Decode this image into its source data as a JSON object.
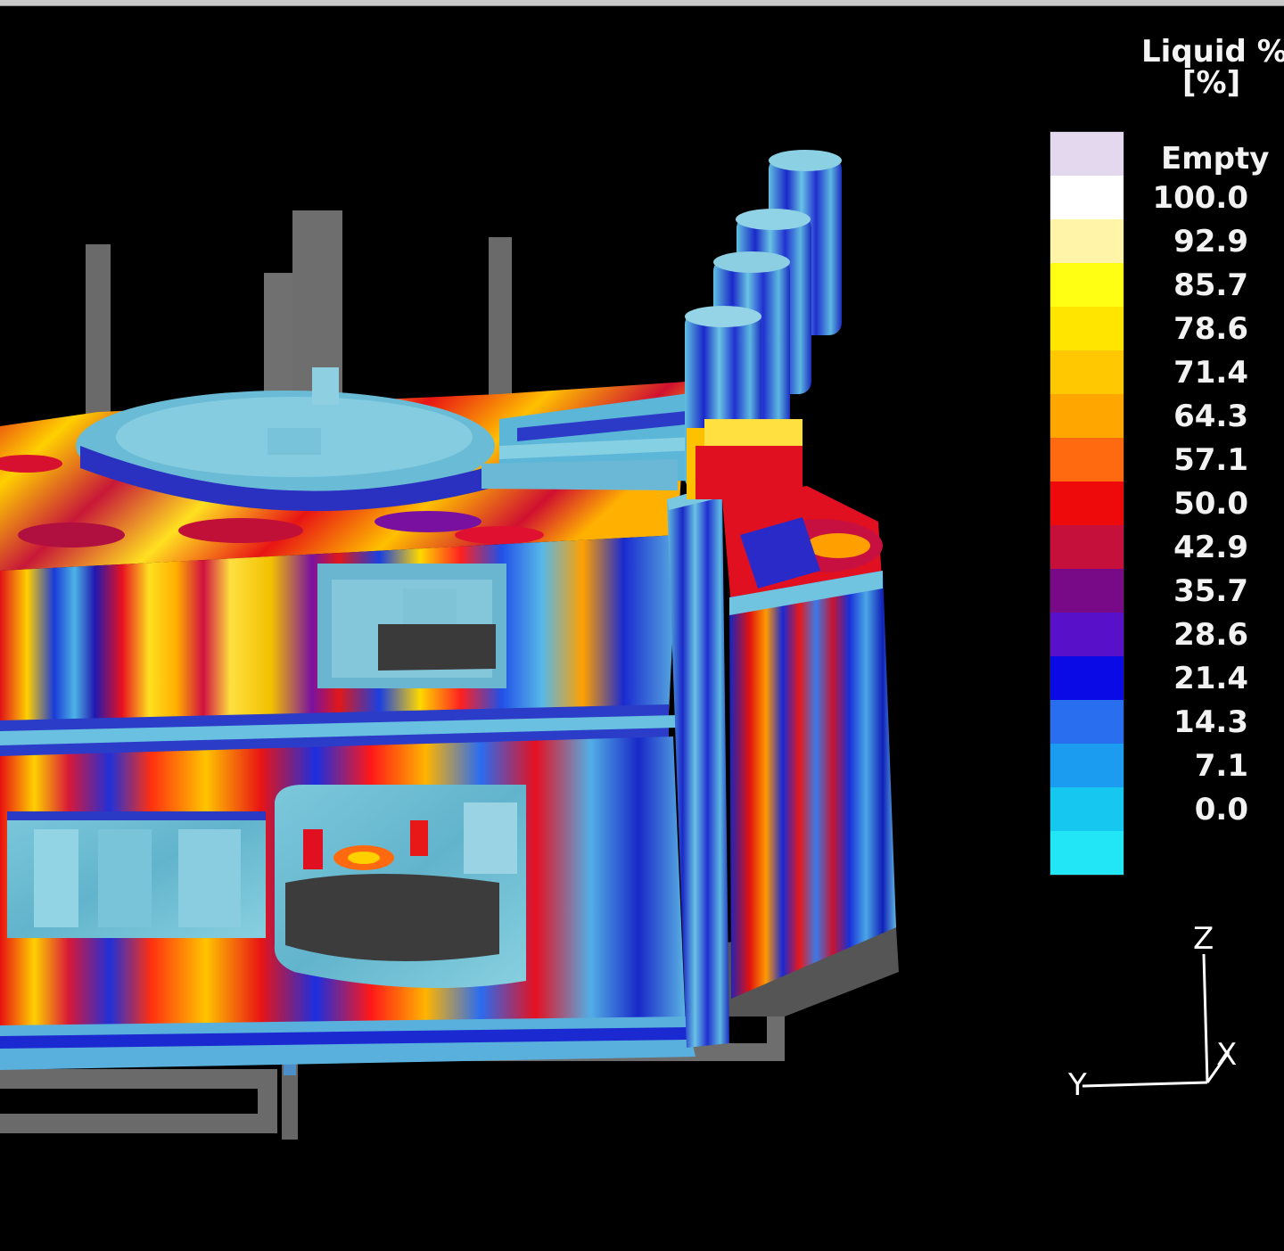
{
  "legend": {
    "title_line1": "Liquid %",
    "title_line2": "[%]",
    "empty_label": "Empty",
    "empty_color": "#e4d8ef",
    "ticks": [
      "100.0",
      "92.9",
      "85.7",
      "78.6",
      "71.4",
      "64.3",
      "57.1",
      "50.0",
      "42.9",
      "35.7",
      "28.6",
      "21.4",
      "14.3",
      "7.1",
      "0.0"
    ],
    "colors": [
      "#ffffff",
      "#fff4a8",
      "#ffff14",
      "#ffe500",
      "#ffc800",
      "#ffa600",
      "#ff6a10",
      "#ee0a0a",
      "#c4103a",
      "#780a88",
      "#5810c8",
      "#0a0ae6",
      "#2a6ef0",
      "#1c9cf0",
      "#16c8f0",
      "#22e6f6"
    ]
  },
  "axes": {
    "z_label": "Z",
    "x_label": "X",
    "y_label": "Y"
  }
}
